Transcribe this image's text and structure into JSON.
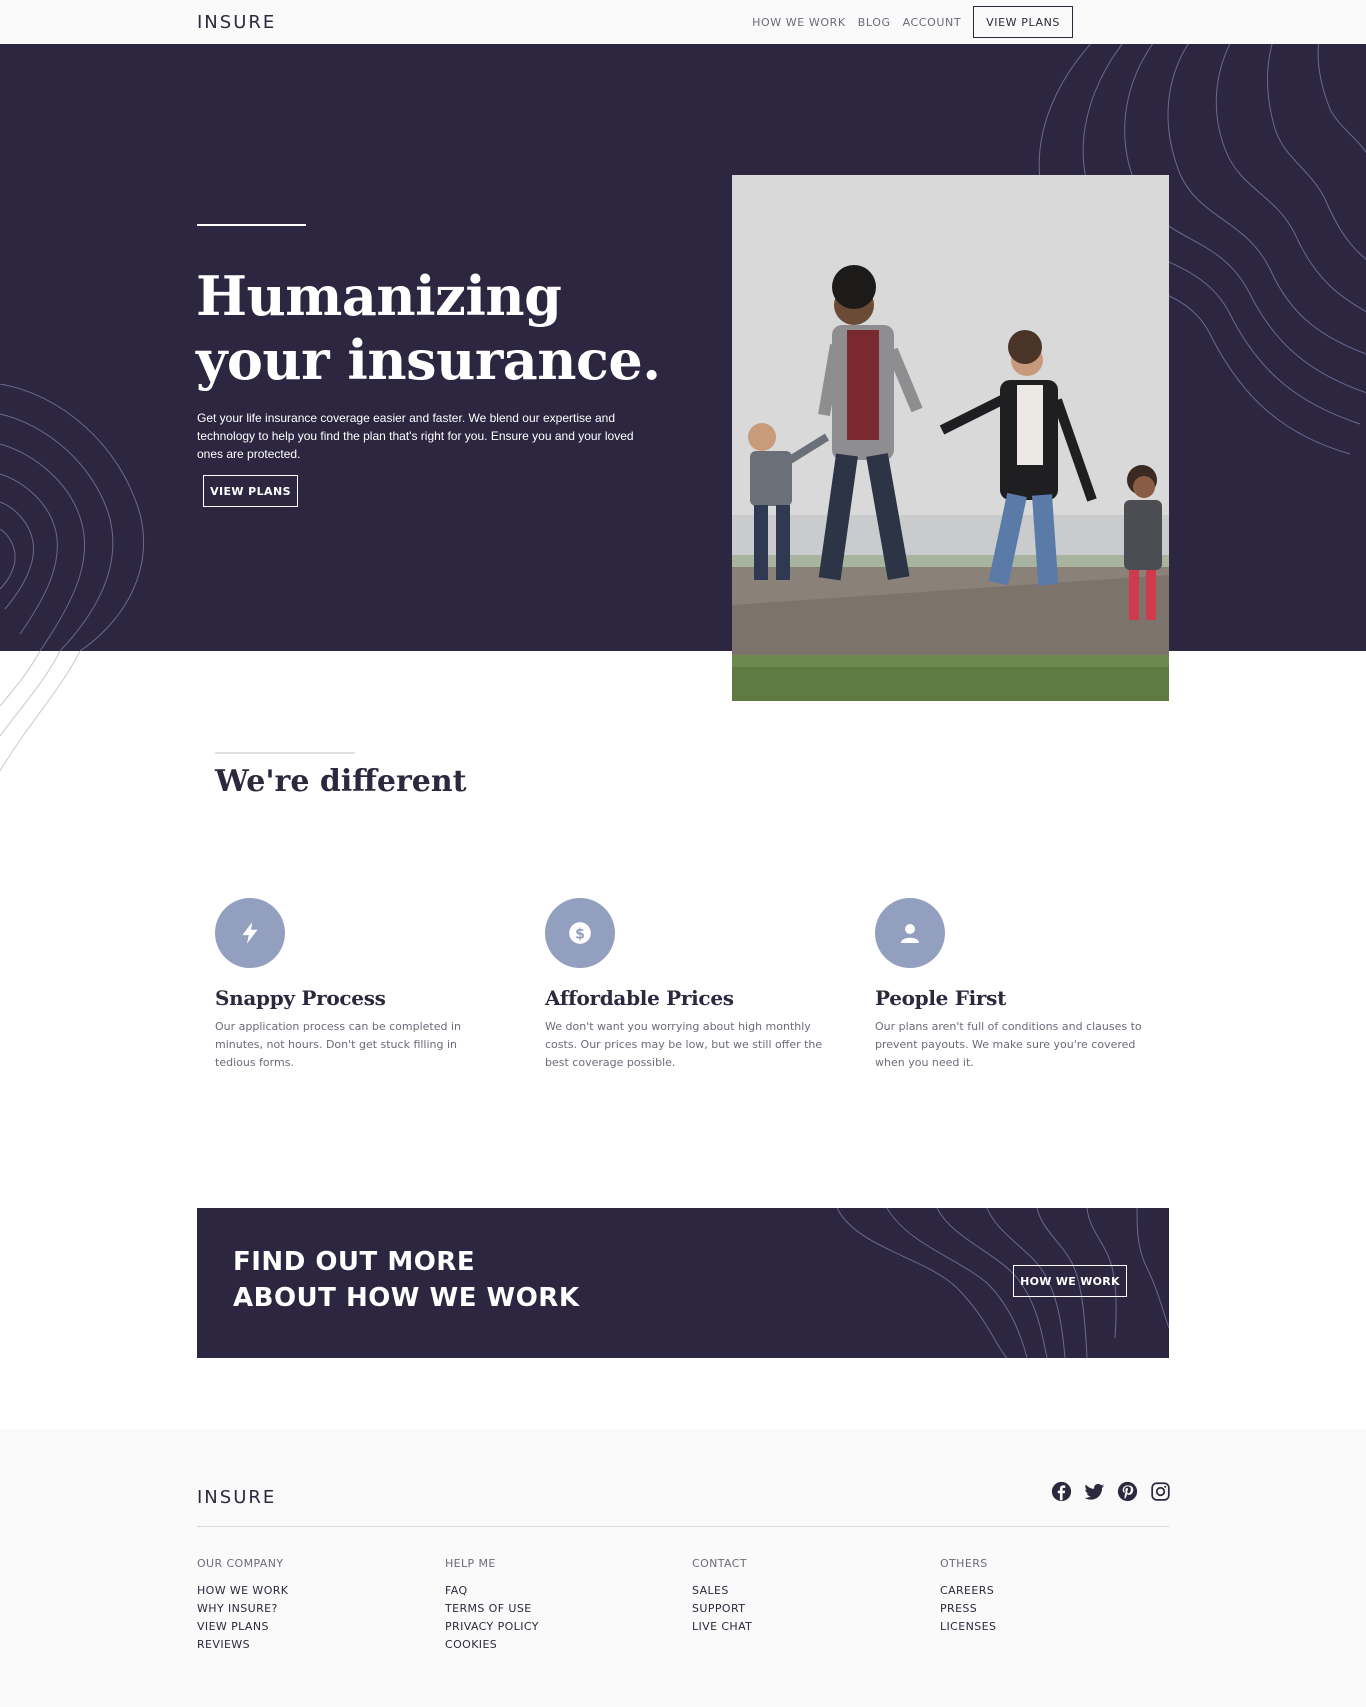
{
  "brand": {
    "logo_text": "INSURE",
    "dark": "#2c2640",
    "accent": "#939fbe"
  },
  "nav": {
    "links": [
      "HOW WE WORK",
      "BLOG",
      "ACCOUNT"
    ],
    "cta_label": "VIEW PLANS"
  },
  "hero": {
    "title_line1": "Humanizing",
    "title_line2": "your insurance.",
    "text": "Get your life insurance coverage easier and faster. We blend our expertise and technology to help you find the plan that's right for you. Ensure you and your loved ones are protected.",
    "button_label": "VIEW PLANS"
  },
  "different": {
    "title": "We're different",
    "features": [
      {
        "icon": "lightning-icon",
        "title": "Snappy Process",
        "text": "Our application process can be completed in minutes, not hours. Don't get stuck filling in tedious forms."
      },
      {
        "icon": "dollar-icon",
        "title": "Affordable Prices",
        "text": "We don't want you worrying about high monthly costs. Our prices may be low, but we still offer the best coverage possible."
      },
      {
        "icon": "person-icon",
        "title": "People First",
        "text": "Our plans aren't full of conditions and clauses to prevent payouts. We make sure you're covered when you need it."
      }
    ]
  },
  "cta": {
    "line1": "FIND OUT MORE",
    "line2": "ABOUT HOW WE WORK",
    "button_label": "HOW WE WORK"
  },
  "footer": {
    "logo_text": "INSURE",
    "socials": [
      "facebook-icon",
      "twitter-icon",
      "pinterest-icon",
      "instagram-icon"
    ],
    "columns": [
      {
        "heading": "OUR COMPANY",
        "links": [
          "HOW WE WORK",
          "WHY INSURE?",
          "VIEW PLANS",
          "REVIEWS"
        ]
      },
      {
        "heading": "HELP ME",
        "links": [
          "FAQ",
          "TERMS OF USE",
          "PRIVACY POLICY",
          "COOKIES"
        ]
      },
      {
        "heading": "CONTACT",
        "links": [
          "SALES",
          "SUPPORT",
          "LIVE CHAT"
        ]
      },
      {
        "heading": "OTHERS",
        "links": [
          "CAREERS",
          "PRESS",
          "LICENSES"
        ]
      }
    ]
  }
}
